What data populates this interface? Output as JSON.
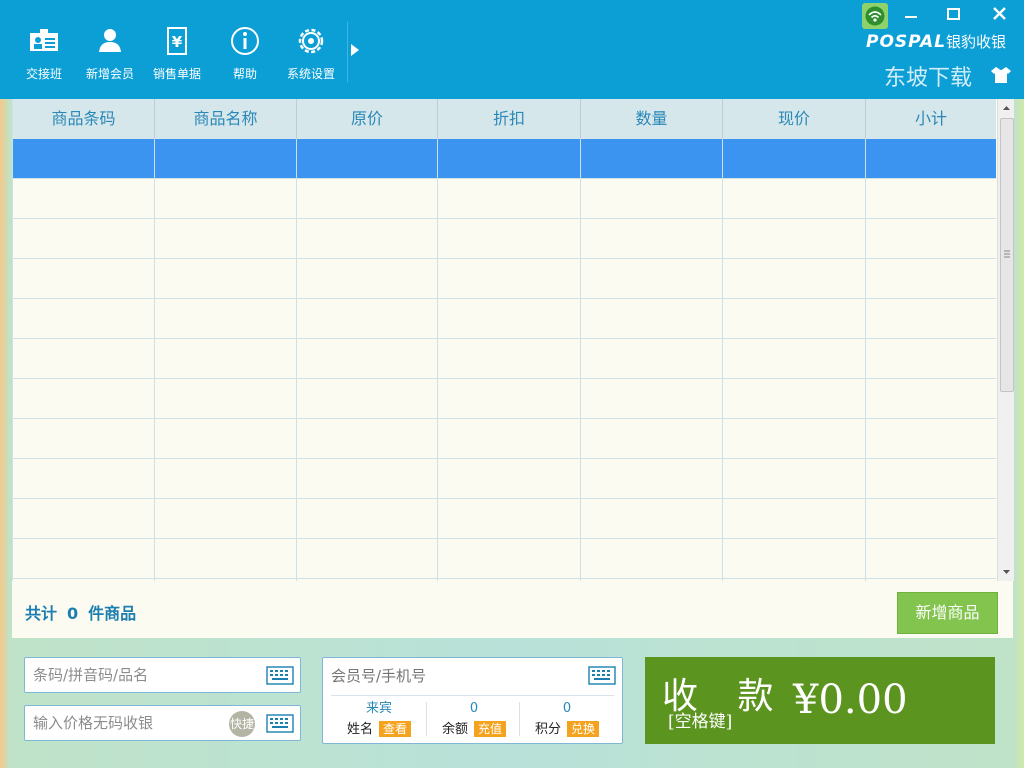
{
  "toolbar": {
    "items": [
      {
        "label": "交接班",
        "icon": "shift-handover-icon"
      },
      {
        "label": "新增会员",
        "icon": "add-member-icon"
      },
      {
        "label": "销售单据",
        "icon": "sales-receipt-icon"
      },
      {
        "label": "帮助",
        "icon": "info-icon"
      },
      {
        "label": "系统设置",
        "icon": "gear-icon"
      }
    ]
  },
  "brand": {
    "logo_en": "POSPAL",
    "logo_cn": "银豹收银",
    "watermark": "东坡下载"
  },
  "colors": {
    "topbar": "#0c9fd6",
    "header_text": "#2a88b6",
    "selected_row": "#3a94f0",
    "add_button": "#82c44d",
    "pay_button": "#5b941f",
    "tag_orange": "#f5a31f"
  },
  "table": {
    "columns": [
      "商品条码",
      "商品名称",
      "原价",
      "折扣",
      "数量",
      "现价",
      "小计"
    ],
    "rows": []
  },
  "summary": {
    "prefix": "共计",
    "count": "0",
    "suffix": "件商品",
    "add_label": "新增商品"
  },
  "inputs": {
    "barcode_placeholder": "条码/拼音码/品名",
    "price_placeholder": "输入价格无码收银",
    "quick_label": "快捷"
  },
  "member": {
    "placeholder": "会员号/手机号",
    "name": {
      "value": "来宾",
      "label": "姓名",
      "tag": "查看"
    },
    "balance": {
      "value": "0",
      "label": "余额",
      "tag": "充值"
    },
    "points": {
      "value": "0",
      "label": "积分",
      "tag": "兑换"
    }
  },
  "pay": {
    "label": "收 款",
    "hotkey": "[空格键]",
    "amount": "¥0.00"
  }
}
